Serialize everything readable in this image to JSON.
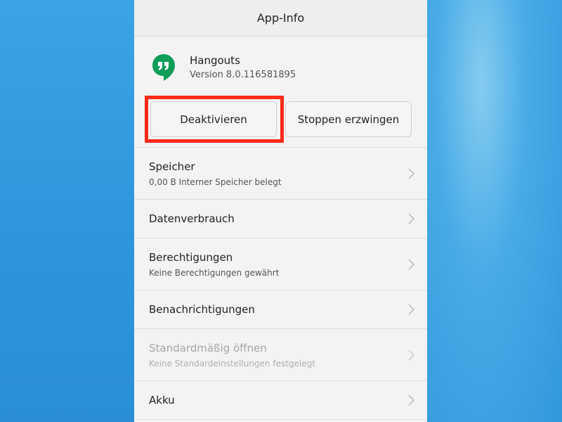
{
  "titlebar": {
    "title": "App-Info"
  },
  "app": {
    "name": "Hangouts",
    "version": "Version 8.0.116581895",
    "icon": "hangouts-quote-bubble-icon",
    "icon_color": "#0f9d58"
  },
  "buttons": {
    "deactivate_label": "Deaktivieren",
    "force_stop_label": "Stoppen erzwingen",
    "highlight_color": "#ff2a18"
  },
  "list": {
    "items": [
      {
        "title": "Speicher",
        "subtitle": "0,00 B Interner Speicher belegt",
        "enabled": true
      },
      {
        "title": "Datenverbrauch",
        "enabled": true
      },
      {
        "title": "Berechtigungen",
        "subtitle": "Keine Berechtigungen gewährt",
        "enabled": true
      },
      {
        "title": "Benachrichtigungen",
        "enabled": true
      },
      {
        "title": "Standardmäßig öffnen",
        "subtitle": "Keine Standardeinstellungen festgelegt",
        "enabled": false
      },
      {
        "title": "Akku",
        "enabled": true
      }
    ],
    "chevron_icon": "chevron-right-icon"
  },
  "colors": {
    "background_blue": "#3aa2e1",
    "screen_bg": "#f3f3f3"
  }
}
